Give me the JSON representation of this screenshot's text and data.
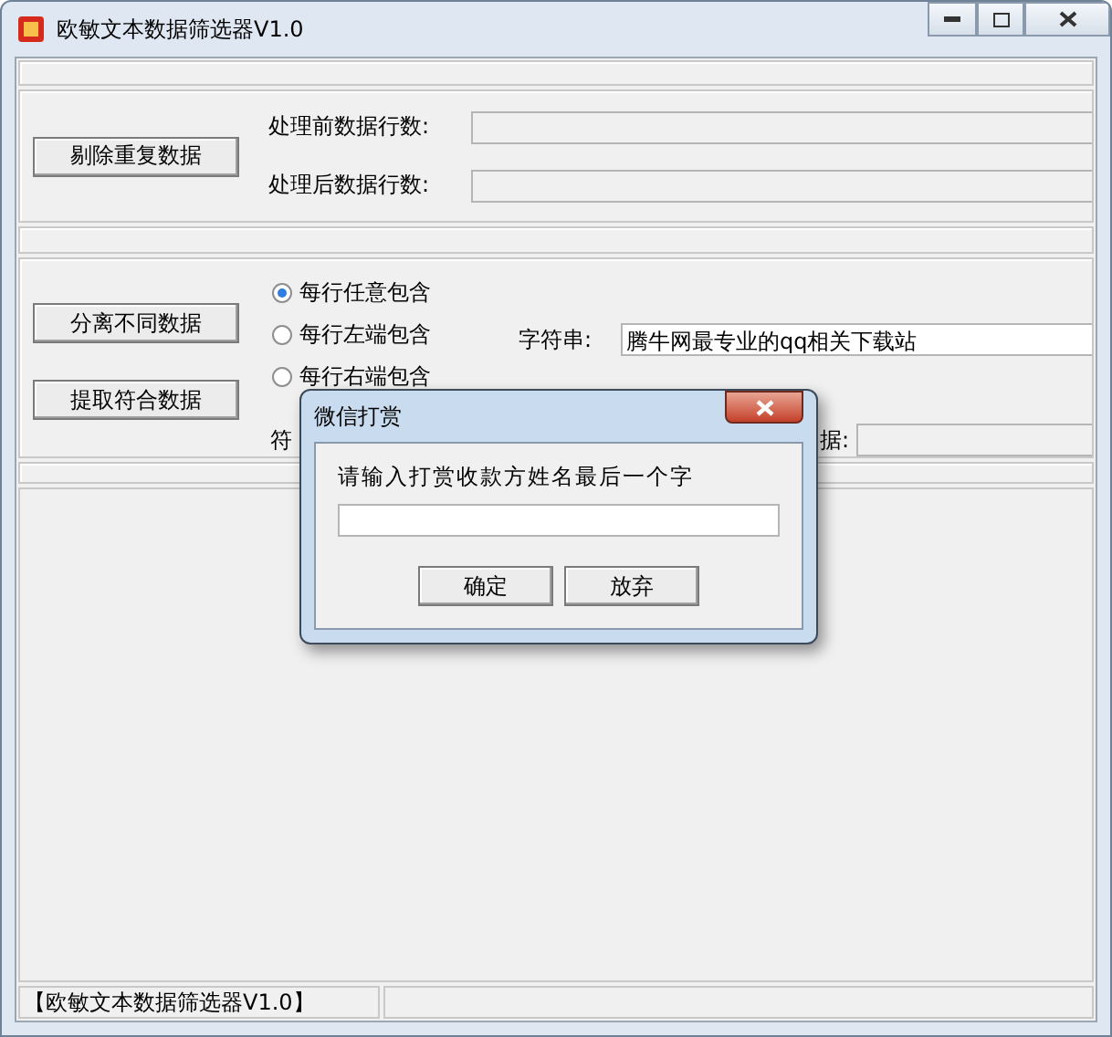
{
  "window": {
    "title": "欧敏文本数据筛选器V1.0"
  },
  "dedupe": {
    "button": "剔除重复数据",
    "rows": [
      {
        "label": "处理前数据行数:"
      },
      {
        "label": "处理后数据行数:"
      }
    ]
  },
  "filter": {
    "buttons": [
      "分离不同数据",
      "提取符合数据"
    ],
    "modes": [
      {
        "label": "每行任意包含",
        "selected": true
      },
      {
        "label": "每行左端包含",
        "selected": false
      },
      {
        "label": "每行右端包含",
        "selected": false
      }
    ],
    "string_label": "字符串:",
    "string_value": "腾牛网最专业的qq相关下载站",
    "match_label": "符",
    "count_label": "据:"
  },
  "status_bar": {
    "text": "【欧敏文本数据筛选器V1.0】"
  },
  "dialog": {
    "title": "微信打赏",
    "prompt": "请输入打赏收款方姓名最后一个字",
    "buttons": [
      "确定",
      "放弃"
    ]
  }
}
